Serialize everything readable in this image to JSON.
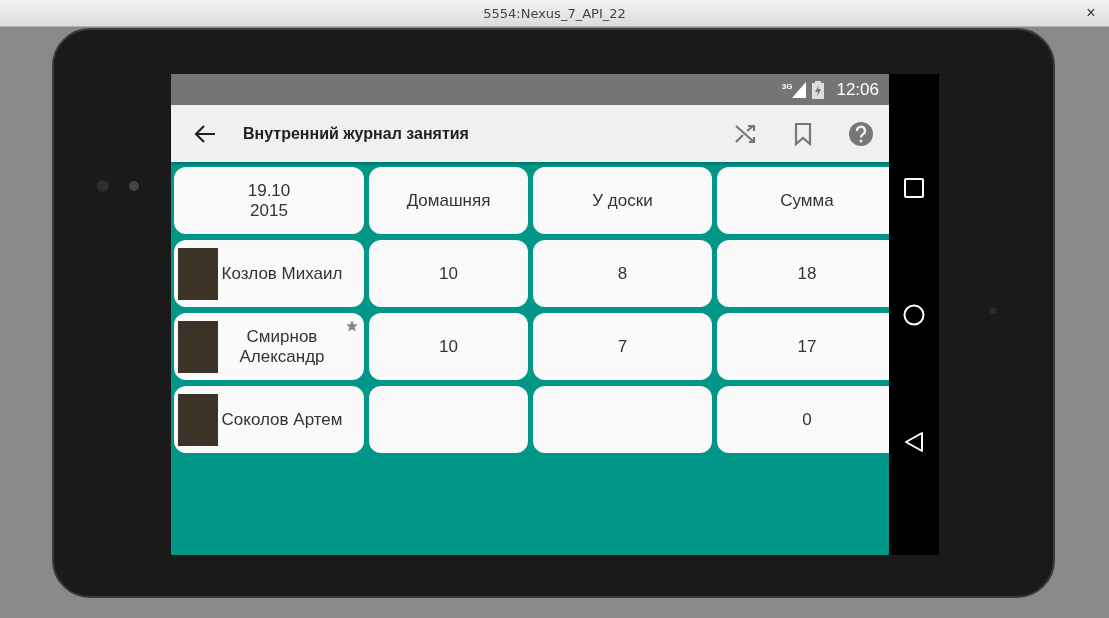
{
  "window": {
    "title": "5554:Nexus_7_API_22",
    "close": "×"
  },
  "status_bar": {
    "network": "3G",
    "time": "12:06"
  },
  "toolbar": {
    "title": "Внутренний журнал занятия"
  },
  "table": {
    "columns": [
      "19.10\n2015",
      "Домашняя",
      "У доски",
      "Сумма"
    ],
    "rows": [
      {
        "name": "Козлов Михаил",
        "starred": false,
        "homework": "10",
        "at_board": "8",
        "total": "18"
      },
      {
        "name": "Смирнов\nАлександр",
        "starred": true,
        "homework": "10",
        "at_board": "7",
        "total": "17"
      },
      {
        "name": "Соколов Артем",
        "starred": false,
        "total": "0"
      }
    ]
  }
}
